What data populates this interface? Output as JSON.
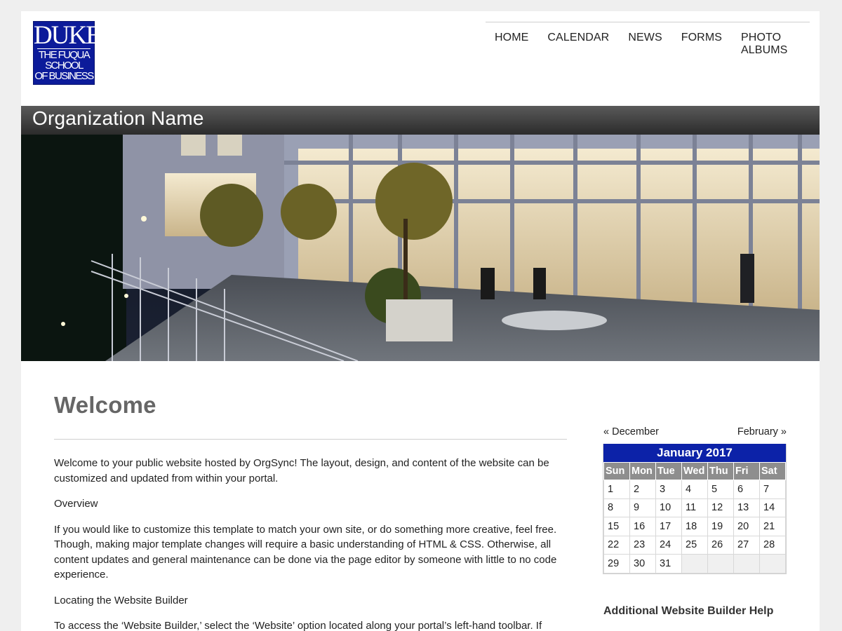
{
  "logo": {
    "line1": "DUKE",
    "line2": "THE FUQUA",
    "line3": "SCHOOL",
    "line4": "OF BUSINESS"
  },
  "nav": [
    "HOME",
    "CALENDAR",
    "NEWS",
    "FORMS",
    "PHOTO ALBUMS"
  ],
  "org_name": "Organization Name",
  "content": {
    "heading": "Welcome",
    "p1": "Welcome to your public website hosted by OrgSync! The layout, design, and content of the website can be customized and updated from within your portal.",
    "p2": "Overview",
    "p3": "If you would like to customize this template to match your own site, or do something more creative, feel free. Though, making major template changes will require a basic understanding of HTML & CSS. Otherwise, all content updates and general maintenance can be done via the page editor by someone with little to no code experience.",
    "p4": "Locating the Website Builder",
    "p5": "To access the ‘Website Builder,’ select the ‘Website’ option located along your portal’s left-hand toolbar. If"
  },
  "calendar": {
    "prev": "« December",
    "next": "February »",
    "title": "January 2017",
    "days": [
      "Sun",
      "Mon",
      "Tue",
      "Wed",
      "Thu",
      "Fri",
      "Sat"
    ],
    "weeks": [
      [
        "1",
        "2",
        "3",
        "4",
        "5",
        "6",
        "7"
      ],
      [
        "8",
        "9",
        "10",
        "11",
        "12",
        "13",
        "14"
      ],
      [
        "15",
        "16",
        "17",
        "18",
        "19",
        "20",
        "21"
      ],
      [
        "22",
        "23",
        "24",
        "25",
        "26",
        "27",
        "28"
      ],
      [
        "29",
        "30",
        "31",
        "",
        "",
        "",
        ""
      ]
    ],
    "header_color": "#0c22a8"
  },
  "sidebar": {
    "help_heading": "Additional Website Builder Help"
  }
}
